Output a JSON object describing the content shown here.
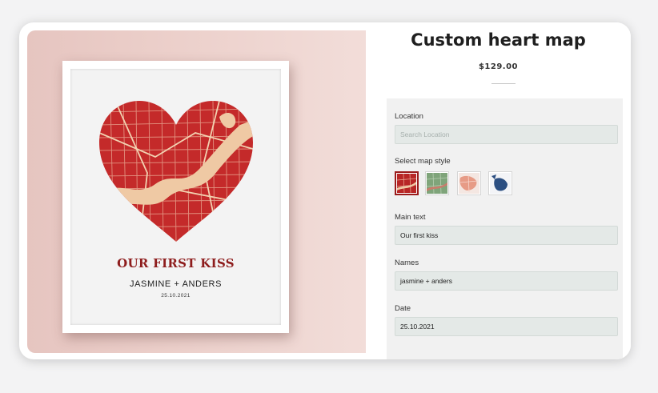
{
  "product": {
    "title": "Custom heart map",
    "price": "$129.00"
  },
  "preview": {
    "main_text": "OUR FIRST KISS",
    "names": "JASMINE + ANDERS",
    "date": "25.10.2021"
  },
  "form": {
    "location_label": "Location",
    "location_placeholder": "Search Location",
    "style_label": "Select map style",
    "styles": [
      {
        "name": "red",
        "color": "#b82626",
        "selected": true
      },
      {
        "name": "green",
        "color": "#7fa47a",
        "selected": false
      },
      {
        "name": "coral",
        "color": "#e79b86",
        "selected": false
      },
      {
        "name": "navy",
        "color": "#2c4f82",
        "selected": false
      }
    ],
    "main_text_label": "Main text",
    "main_text_value": "Our first kiss",
    "names_label": "Names",
    "names_value": "jasmine + anders",
    "date_label": "Date",
    "date_value": "25.10.2021"
  },
  "colors": {
    "map_red": "#c42a2a",
    "river": "#efc9a4",
    "title_red": "#8e1d1d"
  }
}
